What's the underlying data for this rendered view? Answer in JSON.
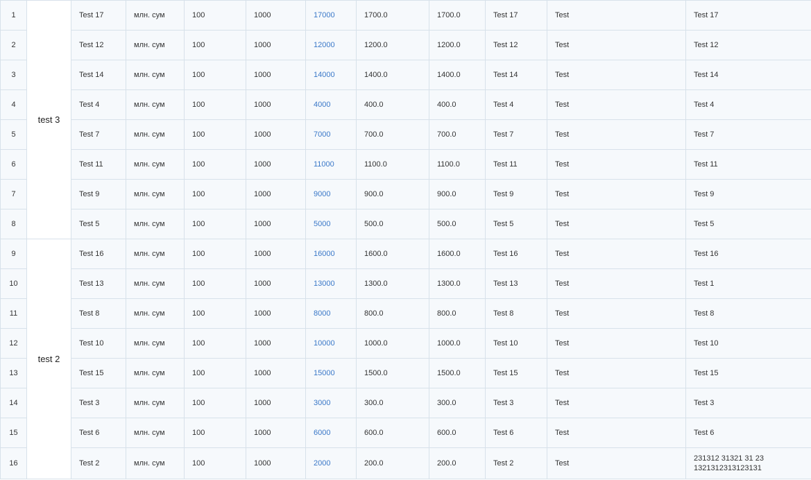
{
  "table": {
    "accent_color": "#3a78c8",
    "groups": [
      {
        "name": "test 3",
        "rows": [
          {
            "n": "1",
            "name": "Test 17",
            "unit": "млн. сум",
            "a": "100",
            "b": "1000",
            "total": "17000",
            "c": "1700.0",
            "d": "1700.0",
            "e": "Test 17",
            "f": "Test",
            "g": "Test 17"
          },
          {
            "n": "2",
            "name": "Test 12",
            "unit": "млн. сум",
            "a": "100",
            "b": "1000",
            "total": "12000",
            "c": "1200.0",
            "d": "1200.0",
            "e": "Test 12",
            "f": "Test",
            "g": "Test 12"
          },
          {
            "n": "3",
            "name": "Test 14",
            "unit": "млн. сум",
            "a": "100",
            "b": "1000",
            "total": "14000",
            "c": "1400.0",
            "d": "1400.0",
            "e": "Test 14",
            "f": "Test",
            "g": "Test 14"
          },
          {
            "n": "4",
            "name": "Test 4",
            "unit": "млн. сум",
            "a": "100",
            "b": "1000",
            "total": "4000",
            "c": "400.0",
            "d": "400.0",
            "e": "Test 4",
            "f": "Test",
            "g": "Test 4"
          },
          {
            "n": "5",
            "name": "Test 7",
            "unit": "млн. сум",
            "a": "100",
            "b": "1000",
            "total": "7000",
            "c": "700.0",
            "d": "700.0",
            "e": "Test 7",
            "f": "Test",
            "g": "Test 7"
          },
          {
            "n": "6",
            "name": "Test 11",
            "unit": "млн. сум",
            "a": "100",
            "b": "1000",
            "total": "11000",
            "c": "1100.0",
            "d": "1100.0",
            "e": "Test 11",
            "f": "Test",
            "g": "Test 11"
          },
          {
            "n": "7",
            "name": "Test 9",
            "unit": "млн. сум",
            "a": "100",
            "b": "1000",
            "total": "9000",
            "c": "900.0",
            "d": "900.0",
            "e": "Test 9",
            "f": "Test",
            "g": "Test 9"
          },
          {
            "n": "8",
            "name": "Test 5",
            "unit": "млн. сум",
            "a": "100",
            "b": "1000",
            "total": "5000",
            "c": "500.0",
            "d": "500.0",
            "e": "Test 5",
            "f": "Test",
            "g": "Test 5"
          }
        ]
      },
      {
        "name": "test 2",
        "rows": [
          {
            "n": "9",
            "name": "Test 16",
            "unit": "млн. сум",
            "a": "100",
            "b": "1000",
            "total": "16000",
            "c": "1600.0",
            "d": "1600.0",
            "e": "Test 16",
            "f": "Test",
            "g": "Test 16"
          },
          {
            "n": "10",
            "name": "Test 13",
            "unit": "млн. сум",
            "a": "100",
            "b": "1000",
            "total": "13000",
            "c": "1300.0",
            "d": "1300.0",
            "e": "Test 13",
            "f": "Test",
            "g": "Test 1"
          },
          {
            "n": "11",
            "name": "Test 8",
            "unit": "млн. сум",
            "a": "100",
            "b": "1000",
            "total": "8000",
            "c": "800.0",
            "d": "800.0",
            "e": "Test 8",
            "f": "Test",
            "g": "Test 8"
          },
          {
            "n": "12",
            "name": "Test 10",
            "unit": "млн. сум",
            "a": "100",
            "b": "1000",
            "total": "10000",
            "c": "1000.0",
            "d": "1000.0",
            "e": "Test 10",
            "f": "Test",
            "g": "Test 10"
          },
          {
            "n": "13",
            "name": "Test 15",
            "unit": "млн. сум",
            "a": "100",
            "b": "1000",
            "total": "15000",
            "c": "1500.0",
            "d": "1500.0",
            "e": "Test 15",
            "f": "Test",
            "g": "Test 15"
          },
          {
            "n": "14",
            "name": "Test 3",
            "unit": "млн. сум",
            "a": "100",
            "b": "1000",
            "total": "3000",
            "c": "300.0",
            "d": "300.0",
            "e": "Test 3",
            "f": "Test",
            "g": "Test 3"
          },
          {
            "n": "15",
            "name": "Test 6",
            "unit": "млн. сум",
            "a": "100",
            "b": "1000",
            "total": "6000",
            "c": "600.0",
            "d": "600.0",
            "e": "Test 6",
            "f": "Test",
            "g": "Test 6"
          },
          {
            "n": "16",
            "name": "Test 2",
            "unit": "млн. сум",
            "a": "100",
            "b": "1000",
            "total": "2000",
            "c": "200.0",
            "d": "200.0",
            "e": "Test 2",
            "f": "Test",
            "g": "231312 31321 31 23 1321312313123131"
          }
        ]
      }
    ]
  }
}
